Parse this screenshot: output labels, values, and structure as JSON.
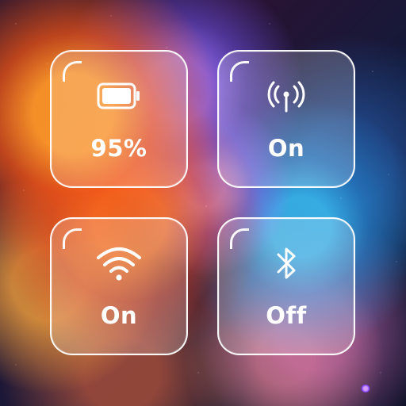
{
  "tiles": {
    "battery": {
      "icon": "battery-icon",
      "value": "95%"
    },
    "cellular": {
      "icon": "cellular-antenna-icon",
      "value": "On"
    },
    "wifi": {
      "icon": "wifi-icon",
      "value": "On"
    },
    "bluetooth": {
      "icon": "bluetooth-icon",
      "value": "Off"
    }
  },
  "colors": {
    "tile_border": "#ffffff",
    "tile_fill": "rgba(255,255,255,0.20)",
    "text": "#ffffff"
  }
}
